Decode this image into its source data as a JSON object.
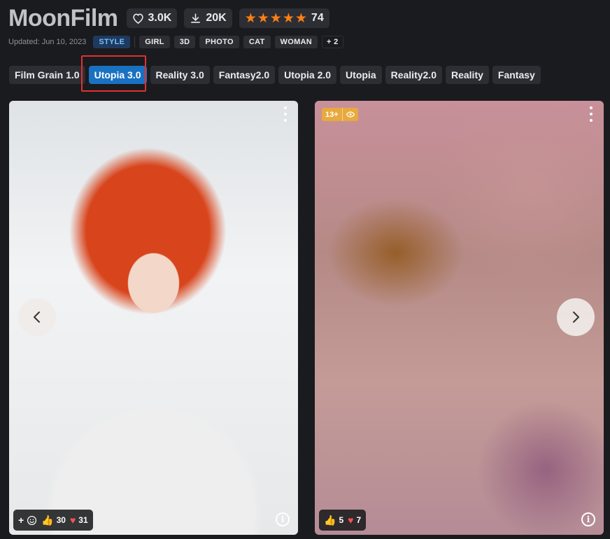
{
  "header": {
    "title": "MoonFilm",
    "likes": "3.0K",
    "downloads": "20K",
    "rating_count": "74",
    "rating": 5
  },
  "meta": {
    "updated": "Updated: Jun 10, 2023",
    "type_tag": "STYLE",
    "tags": [
      "GIRL",
      "3D",
      "PHOTO",
      "CAT",
      "WOMAN"
    ],
    "more": "+ 2"
  },
  "versions": [
    {
      "label": "Film Grain 1.0",
      "active": false
    },
    {
      "label": "Utopia 3.0",
      "active": true
    },
    {
      "label": "Reality 3.0",
      "active": false
    },
    {
      "label": "Fantasy2.0",
      "active": false
    },
    {
      "label": "Utopia 2.0",
      "active": false
    },
    {
      "label": "Utopia",
      "active": false
    },
    {
      "label": "Reality2.0",
      "active": false
    },
    {
      "label": "Reality",
      "active": false
    },
    {
      "label": "Fantasy",
      "active": false
    }
  ],
  "cards": [
    {
      "thumbs": "30",
      "hearts": "31",
      "has_add_reaction": true
    },
    {
      "thumbs": "5",
      "hearts": "7",
      "rating_badge": "13+"
    }
  ],
  "colors": {
    "accent": "#1971c2",
    "highlight": "#e03131",
    "star": "#fd7e14",
    "badge": "#e8a93d"
  }
}
